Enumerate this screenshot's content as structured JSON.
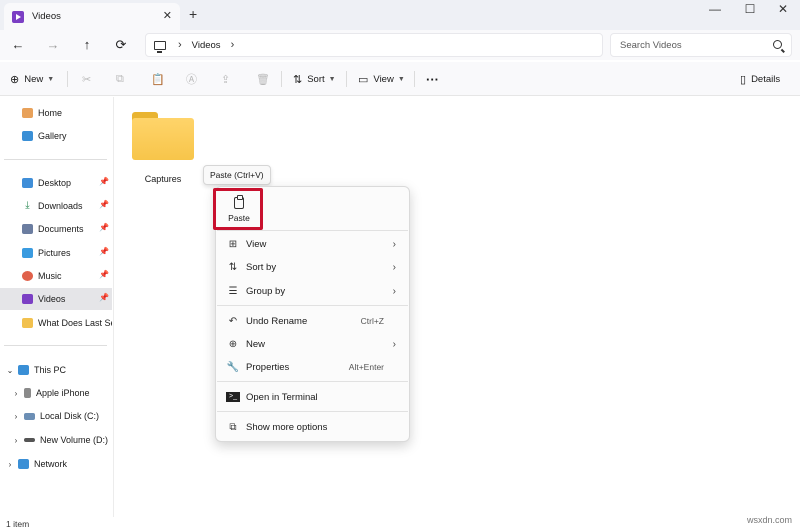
{
  "window": {
    "tab_title": "Videos",
    "tab_close": "✕",
    "new_tab": "+",
    "minimize": "—",
    "maximize": "☐",
    "close": "✕"
  },
  "nav": {
    "back": "←",
    "forward": "→",
    "up": "↑",
    "refresh": "⟳",
    "breadcrumb": [
      "Videos"
    ],
    "search_placeholder": "Search Videos"
  },
  "toolbar": {
    "new_label": "New",
    "sort_label": "Sort",
    "view_label": "View",
    "more_label": "···",
    "details_label": "Details"
  },
  "sidebar": {
    "top": [
      {
        "label": "Home",
        "icon": "home-icon"
      },
      {
        "label": "Gallery",
        "icon": "gallery-icon"
      }
    ],
    "quick_access": [
      {
        "label": "Desktop",
        "icon": "desktop-icon",
        "pinned": true
      },
      {
        "label": "Downloads",
        "icon": "download-icon",
        "pinned": true
      },
      {
        "label": "Documents",
        "icon": "documents-icon",
        "pinned": true
      },
      {
        "label": "Pictures",
        "icon": "pictures-icon",
        "pinned": true
      },
      {
        "label": "Music",
        "icon": "music-icon",
        "pinned": true
      },
      {
        "label": "Videos",
        "icon": "videos-icon",
        "pinned": true,
        "selected": true
      },
      {
        "label": "What Does Last See",
        "icon": "folder-icon",
        "pinned": false
      }
    ],
    "this_pc": [
      {
        "label": "This PC",
        "icon": "pc-icon",
        "expanded": true
      },
      {
        "label": "Apple iPhone",
        "icon": "phone-icon"
      },
      {
        "label": "Local Disk (C:)",
        "icon": "disk-icon"
      },
      {
        "label": "New Volume (D:)",
        "icon": "drive-icon"
      }
    ],
    "network": {
      "label": "Network",
      "icon": "network-icon"
    }
  },
  "content": {
    "items": [
      {
        "name": "Captures",
        "type": "folder"
      }
    ]
  },
  "tooltip": {
    "text": "Paste (Ctrl+V)"
  },
  "context_menu": {
    "paste_label": "Paste",
    "items": [
      {
        "label": "View",
        "icon": "grid-icon",
        "submenu": true
      },
      {
        "label": "Sort by",
        "icon": "sort-icon",
        "submenu": true
      },
      {
        "label": "Group by",
        "icon": "group-icon",
        "submenu": true
      },
      {
        "label": "Undo Rename",
        "icon": "undo-icon",
        "shortcut": "Ctrl+Z"
      },
      {
        "label": "New",
        "icon": "plus-circle-icon",
        "submenu": true
      },
      {
        "label": "Properties",
        "icon": "wrench-icon",
        "shortcut": "Alt+Enter"
      },
      {
        "label": "Open in Terminal",
        "icon": "terminal-icon"
      },
      {
        "label": "Show more options",
        "icon": "share-icon"
      }
    ],
    "highlight_color": "#c8102e"
  },
  "status": {
    "item_count": "1 item",
    "watermark": "wsxdn.com"
  }
}
